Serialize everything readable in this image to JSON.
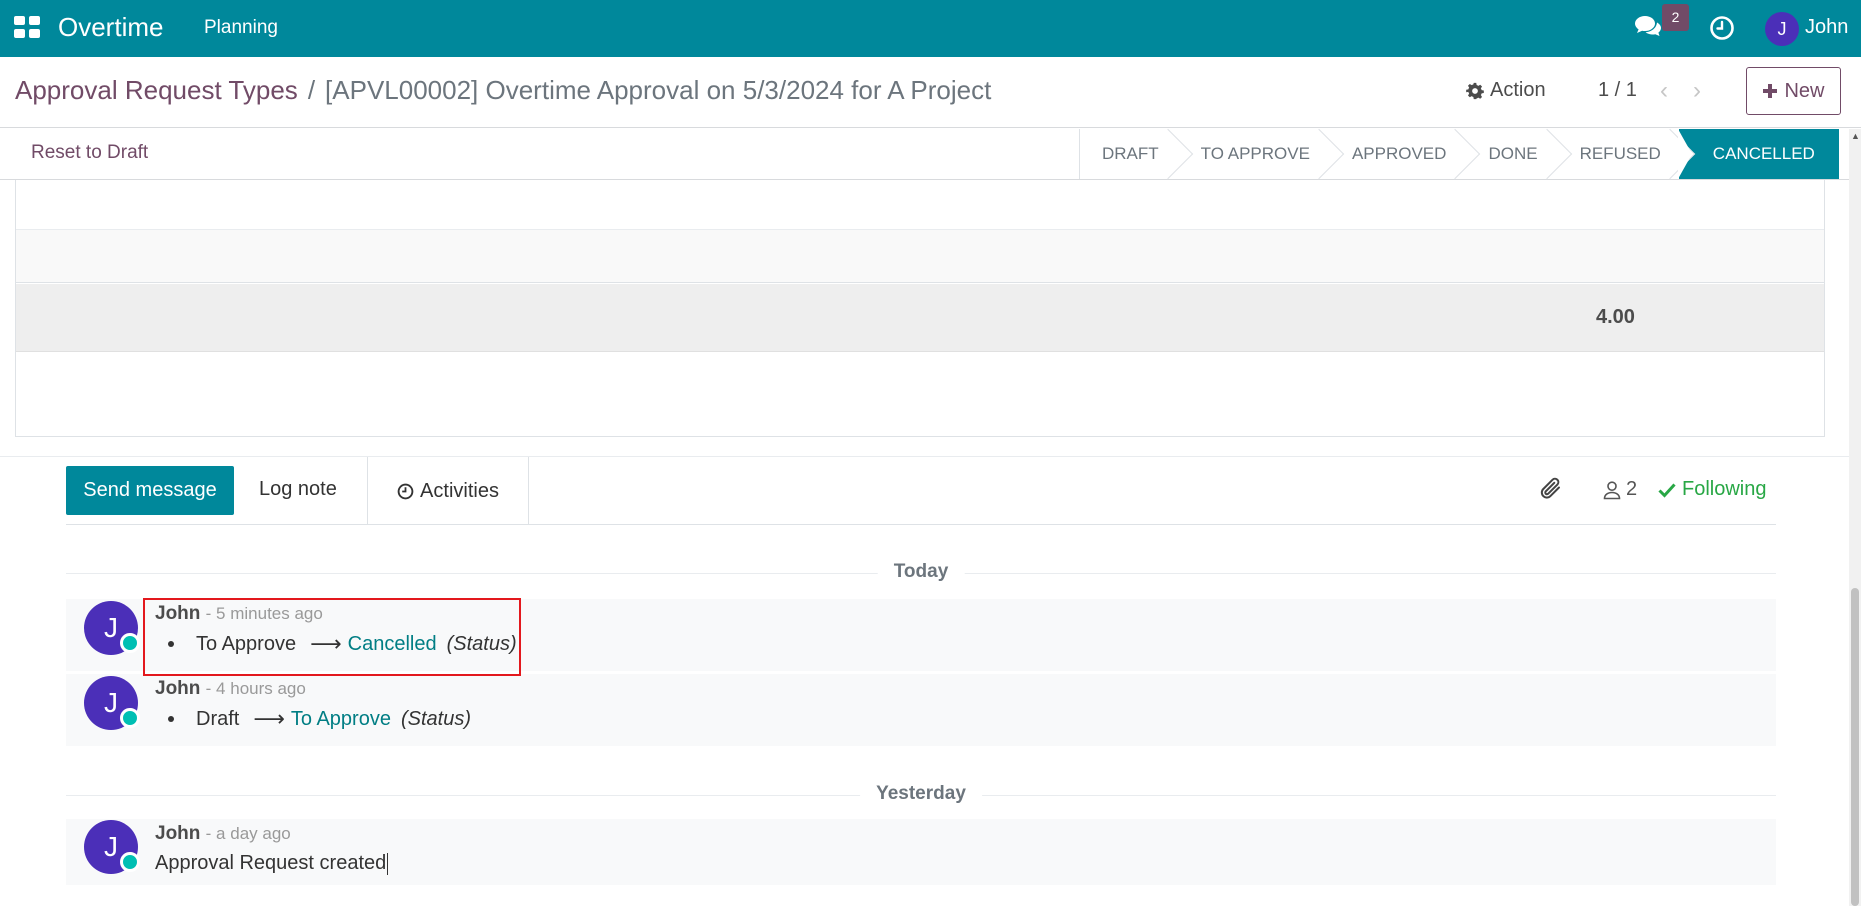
{
  "navbar": {
    "app_name": "Overtime",
    "menu": [
      "Planning"
    ],
    "chat_badge": "2",
    "user_initial": "J",
    "user_name": "John"
  },
  "breadcrumb": {
    "parent": "Approval Request Types",
    "separator": "/",
    "current": "[APVL00002] Overtime Approval on 5/3/2024 for A Project"
  },
  "toolbar": {
    "action_label": "Action",
    "pager": "1 / 1",
    "new_label": "New"
  },
  "statusbar": {
    "reset_label": "Reset to Draft",
    "stages": [
      "DRAFT",
      "TO APPROVE",
      "APPROVED",
      "DONE",
      "REFUSED",
      "CANCELLED"
    ],
    "active_stage": "CANCELLED"
  },
  "form": {
    "total_value": "4.00"
  },
  "chatter": {
    "send_message": "Send message",
    "log_note": "Log note",
    "activities": "Activities",
    "followers_count": "2",
    "following_label": "Following",
    "groups": [
      {
        "date": "Today",
        "messages": [
          {
            "author": "John",
            "time": "- 5 minutes ago",
            "old_value": "To Approve",
            "new_value": "Cancelled",
            "field": "(Status)"
          },
          {
            "author": "John",
            "time": "- 4 hours ago",
            "old_value": "Draft",
            "new_value": "To Approve",
            "field": "(Status)"
          }
        ]
      },
      {
        "date": "Yesterday",
        "messages": [
          {
            "author": "John",
            "time": "- a day ago",
            "body": "Approval Request created"
          }
        ]
      }
    ]
  },
  "colors": {
    "primary": "#00889b",
    "brand": "#714b67",
    "avatar": "#4b2fb8",
    "highlight": "#e3181d",
    "following": "#28a745"
  }
}
